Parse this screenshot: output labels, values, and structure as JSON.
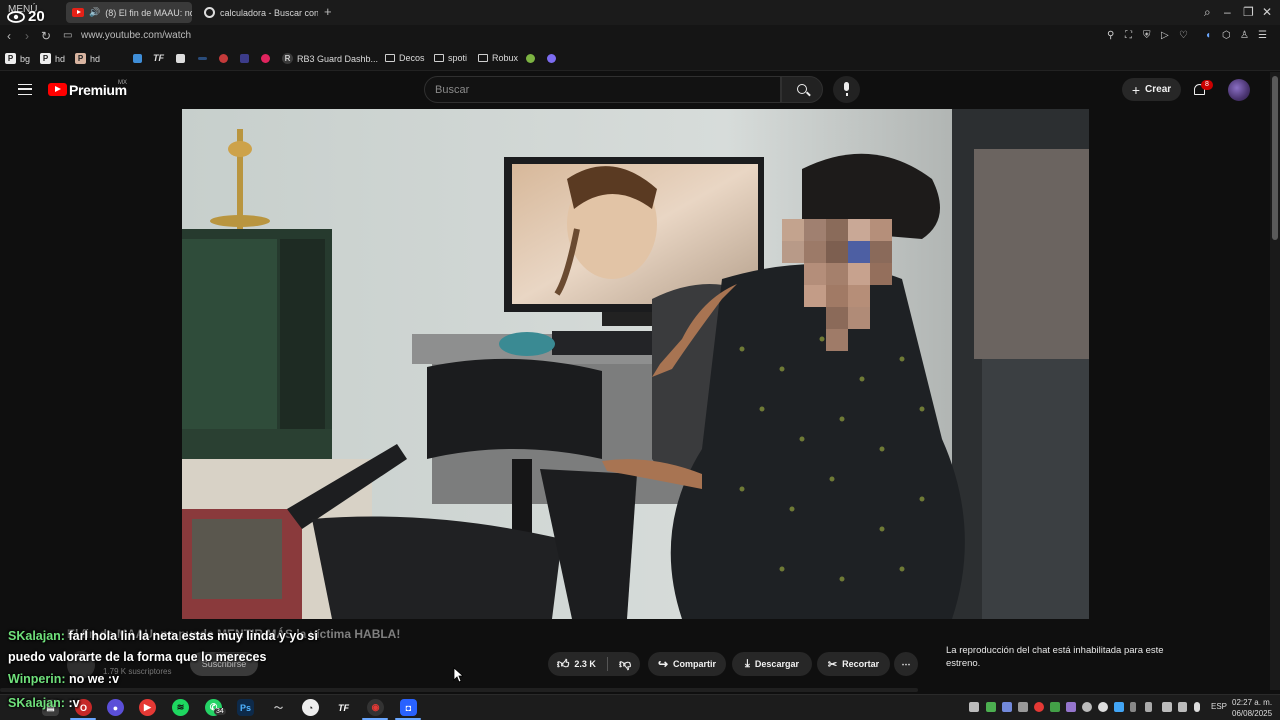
{
  "browser": {
    "menu_label": "MENÚ",
    "tabs": [
      {
        "label": "(8) El fin de MAAU: no",
        "active": true
      },
      {
        "label": "calculadora - Buscar con",
        "active": false
      }
    ],
    "url": "www.youtube.com/watch"
  },
  "bookmarks": [
    {
      "label": "bg"
    },
    {
      "label": "hd"
    },
    {
      "label": "hd"
    },
    {
      "label": "TF"
    },
    {
      "label": "RB3 Guard Dashb..."
    },
    {
      "label": "Decos"
    },
    {
      "label": "spoti"
    },
    {
      "label": "Robux"
    }
  ],
  "youtube": {
    "brand": "Premium",
    "region": "MX",
    "search_placeholder": "Buscar",
    "create_label": "Crear",
    "notification_count": "8"
  },
  "overlay": {
    "viewer_count": "20"
  },
  "video_info": {
    "title": "El fin de MAAU: no puede MENTIR MÁS la víctima HABLA!",
    "subscribers": "1.79 K suscriptores",
    "subscribe_label": "Suscribirse"
  },
  "actions": {
    "likes": "2.3 K",
    "share_label": "Compartir",
    "download_label": "Descargar",
    "clip_label": "Recortar",
    "more_label": "⋯"
  },
  "chat_panel": {
    "message": "La reproducción del chat está inhabilitada para este estreno."
  },
  "stream_chat": [
    {
      "user": "SKalajan:",
      "text": "farl hola lin la neta estas muy linda y yo si"
    },
    {
      "user": "",
      "text": "puedo valorarte de la forma que lo mereces"
    },
    {
      "user": "Winperin:",
      "text": "no we :v"
    },
    {
      "user": "SKalajan:",
      "text": ":v"
    }
  ],
  "taskbar": {
    "badge": "34",
    "language": "ESP",
    "time": "02:27 a. m.",
    "date": "06/08/2025"
  },
  "colors": {
    "yt_red": "#ff0000",
    "chat_username": "#6fe07b",
    "background": "#0f0f0f"
  }
}
